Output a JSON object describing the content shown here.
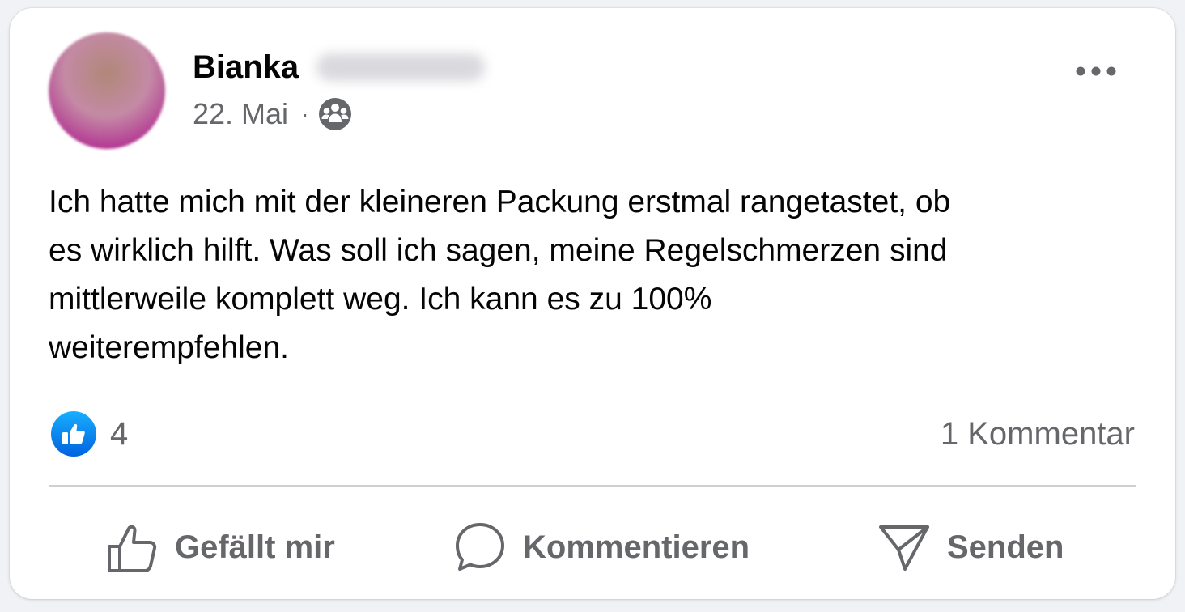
{
  "post": {
    "author_first_name": "Bianka",
    "date": "22. Mai",
    "separator": "·",
    "audience_icon": "group-icon",
    "text": "Ich hatte mich mit der kleineren Packung erstmal rangetastet, ob\nes wirklich hilft. Was soll ich sagen, meine Regelschmerzen sind\nmittlerweile komplett weg. Ich kann es zu 100%\nweiterempfehlen."
  },
  "stats": {
    "reaction_icon": "like-icon",
    "reaction_count": "4",
    "comment_count": "1 Kommentar"
  },
  "actions": {
    "like_label": "Gefällt mir",
    "comment_label": "Kommentieren",
    "share_label": "Senden"
  },
  "colors": {
    "like_blue": "#1877f2",
    "secondary_text": "#65676b",
    "primary_text": "#050505"
  }
}
